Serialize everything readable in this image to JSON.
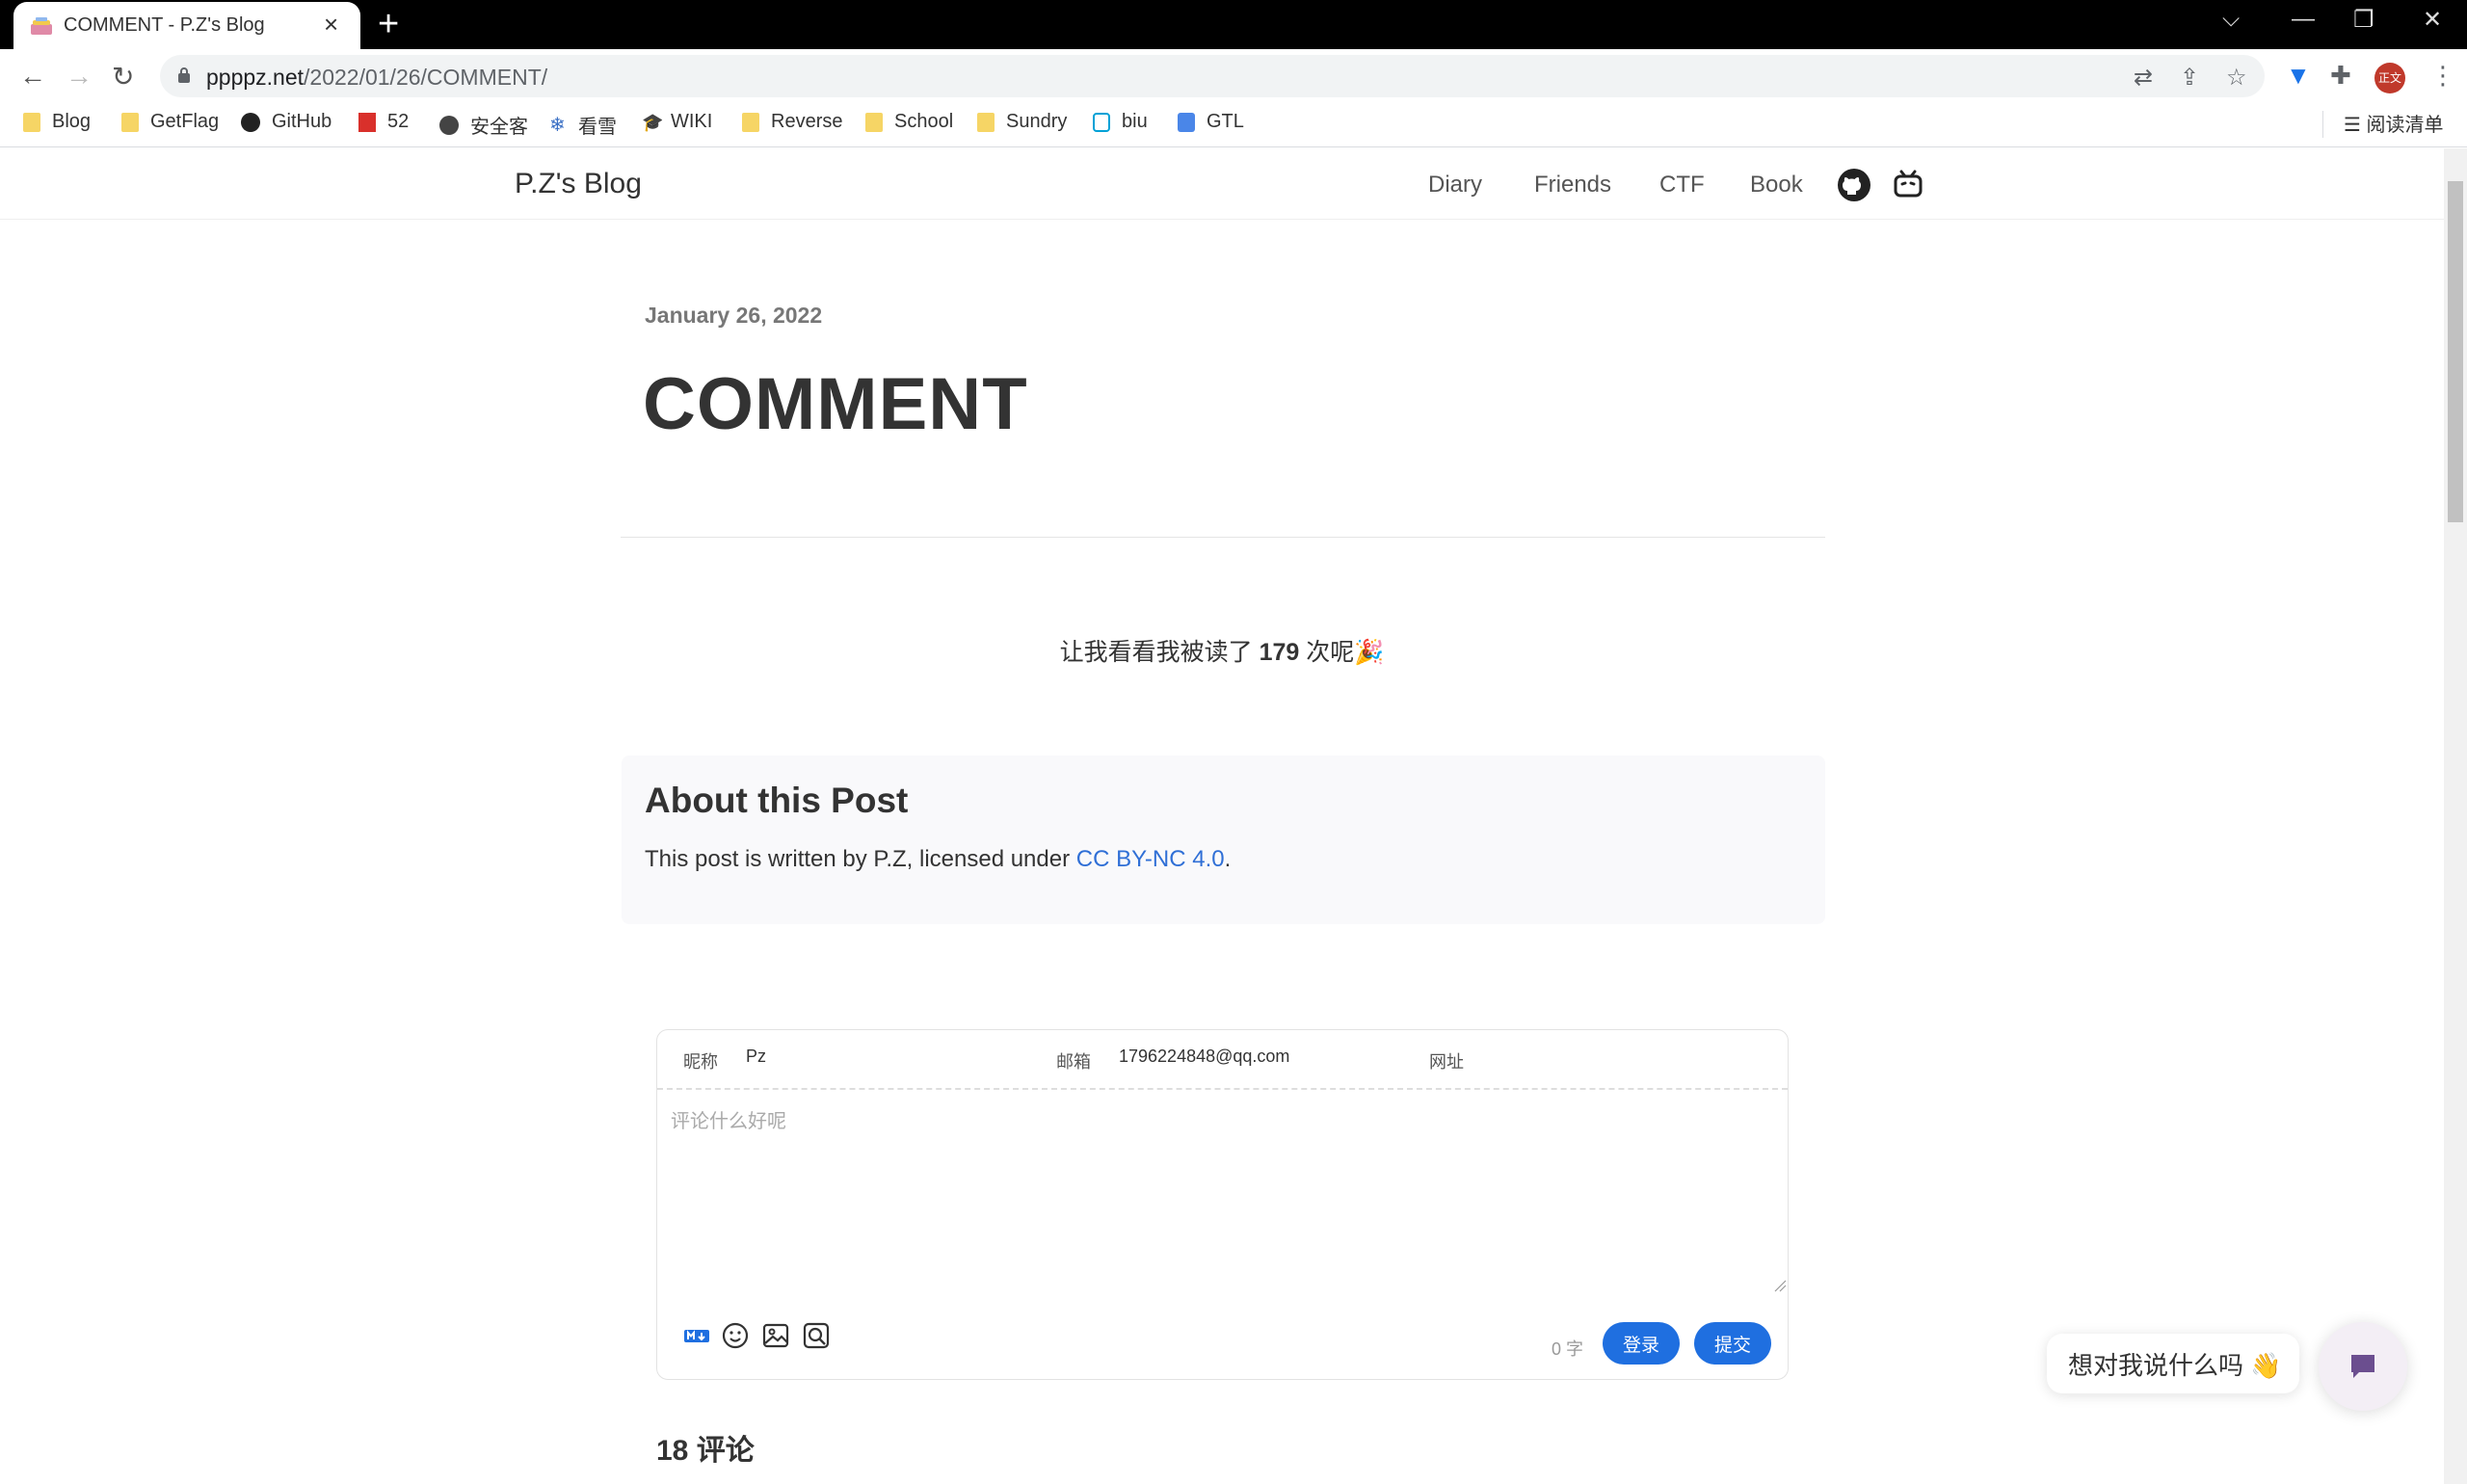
{
  "browser": {
    "tab_title": "COMMENT - P.Z's Blog",
    "url_host": "ppppz.net",
    "url_path": "/2022/01/26/COMMENT/",
    "bookmarks": [
      "Blog",
      "GetFlag",
      "GitHub",
      "52",
      "安全客",
      "看雪",
      "WIKI",
      "Reverse",
      "School",
      "Sundry",
      "biu",
      "GTL"
    ],
    "reading_list": "阅读清单",
    "profile_badge": "正文"
  },
  "site": {
    "title": "P.Z's Blog",
    "nav": [
      "Diary",
      "Friends",
      "CTF",
      "Book"
    ]
  },
  "post": {
    "date": "January 26, 2022",
    "title": "COMMENT",
    "read_prefix": "让我看看我被读了 ",
    "read_count": "179",
    "read_suffix": " 次呢",
    "about_heading": "About this Post",
    "about_text_before": "This post is written by P.Z, licensed under ",
    "about_license": "CC BY-NC 4.0",
    "about_text_after": "."
  },
  "comment_form": {
    "nick_label": "昵称",
    "nick_value": "Pz",
    "email_label": "邮箱",
    "email_value": "1796224848@qq.com",
    "site_label": "网址",
    "site_value": "",
    "placeholder": "评论什么好呢",
    "word_count": "0 字",
    "login_label": "登录",
    "submit_label": "提交"
  },
  "comments": {
    "count_label": "18 评论"
  },
  "chat": {
    "bubble_text": "想对我说什么吗 👋"
  },
  "colors": {
    "accent": "#1f6fe0",
    "link": "#2f6fd6"
  }
}
